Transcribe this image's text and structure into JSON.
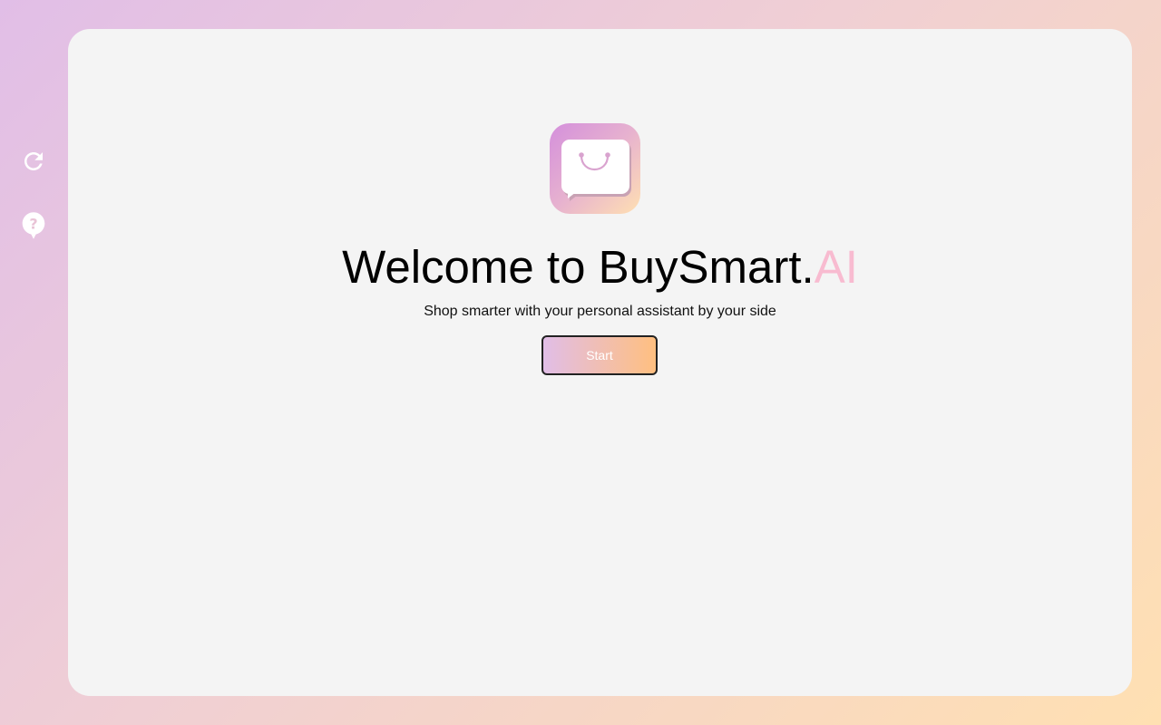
{
  "app": {
    "title_main": "Welcome to BuySmart.",
    "title_accent": "AI",
    "subtitle": "Shop smarter with your personal assistant by your side",
    "start_label": "Start"
  },
  "side_rail": {
    "icons": [
      "refresh-icon",
      "help-icon"
    ]
  },
  "logo": {
    "icon": "shopping-bag-chat-icon"
  },
  "colors": {
    "accent_pink": "#f8bbd0",
    "panel_bg": "#f4f4f4",
    "gradient_start": "#e1bee7",
    "gradient_end": "#ffe0b2",
    "button_gradient_end": "#ffbf80"
  }
}
